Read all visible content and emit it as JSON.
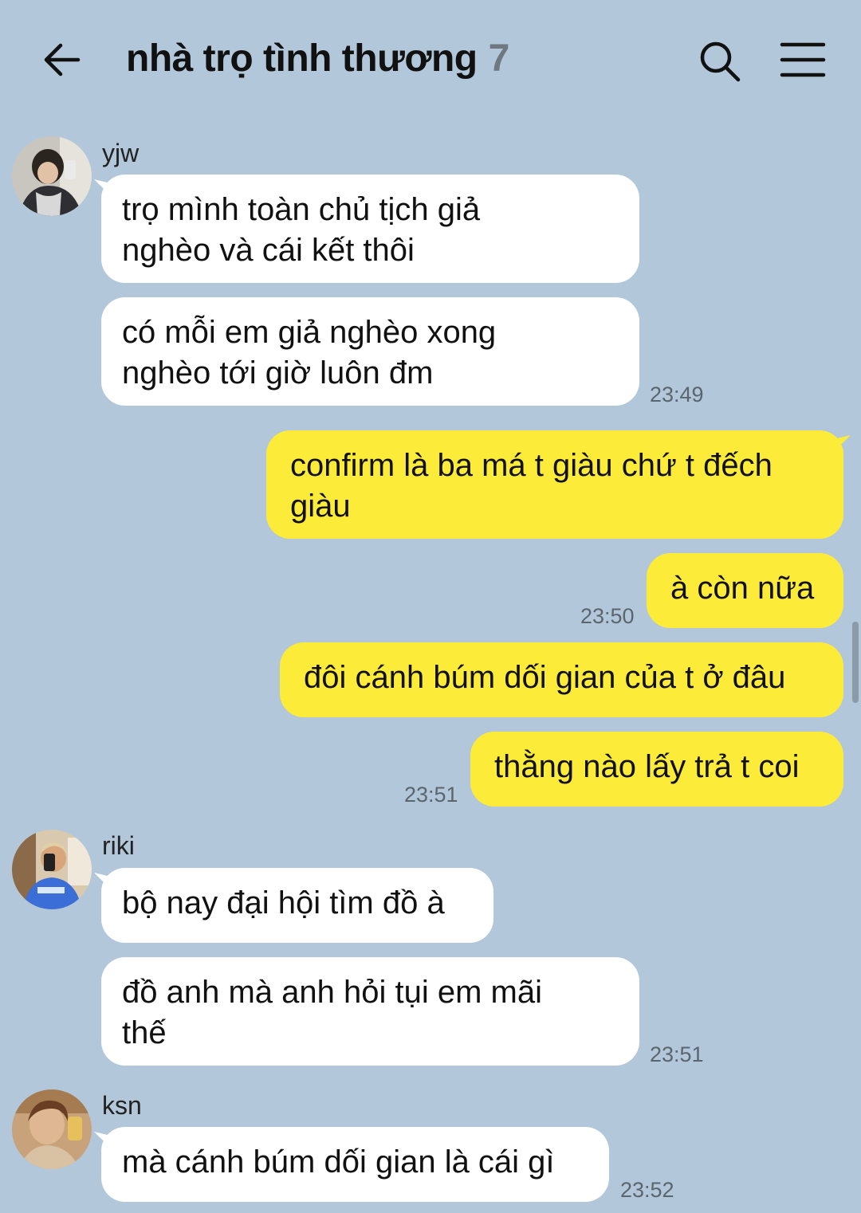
{
  "header": {
    "title": "nhà trọ tình thương",
    "member_count": "7"
  },
  "messages": [
    {
      "sender": "yjw",
      "text": "trọ mình toàn chủ tịch giả\nnghèo và cái kết thôi"
    },
    {
      "text": "có mỗi em giả nghèo xong\nnghèo tới giờ luôn đm",
      "time": "23:49"
    },
    {
      "text": "confirm là ba má t giàu chứ t đếch\ngiàu"
    },
    {
      "text": "à còn nữa",
      "time": "23:50"
    },
    {
      "text": "đôi cánh búm dối gian của t ở đâu"
    },
    {
      "text": "thằng nào lấy trả t coi",
      "time": "23:51"
    },
    {
      "sender": "riki",
      "text": "bộ nay đại hội tìm đồ à"
    },
    {
      "text": "đồ anh mà anh hỏi tụi em mãi\nthế",
      "time": "23:51"
    },
    {
      "sender": "ksn",
      "text": "mà cánh búm dối gian là cái gì",
      "time": "23:52"
    }
  ],
  "icons": {
    "back": "arrow-left-icon",
    "search": "search-icon",
    "menu": "hamburger-menu-icon"
  },
  "colors": {
    "background": "#b2c7d9",
    "incoming_bubble": "#ffffff",
    "outgoing_bubble": "#fdeb3a"
  }
}
